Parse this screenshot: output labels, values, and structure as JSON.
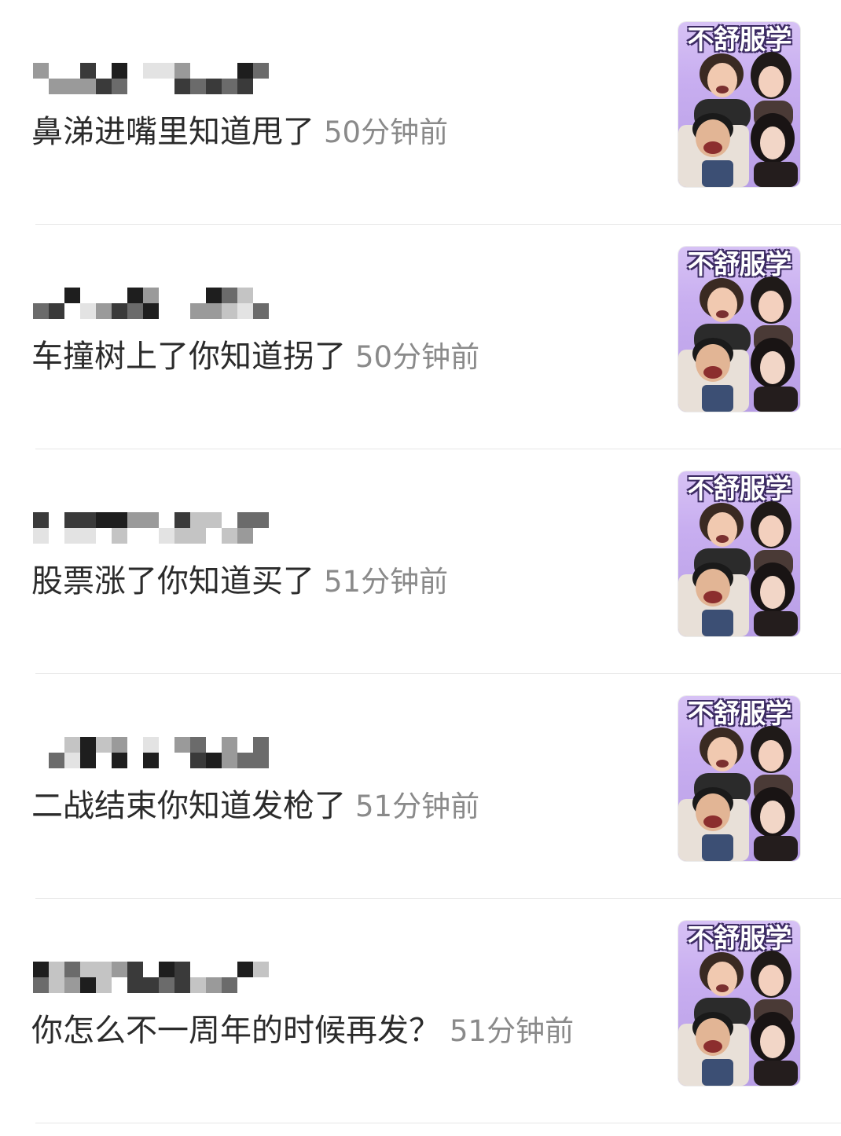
{
  "comments": [
    {
      "text": "鼻涕进嘴里知道甩了",
      "time": "50分钟前",
      "sticker_label": "不舒服学"
    },
    {
      "text": "车撞树上了你知道拐了",
      "time": "50分钟前",
      "sticker_label": "不舒服学"
    },
    {
      "text": "股票涨了你知道买了",
      "time": "51分钟前",
      "sticker_label": "不舒服学"
    },
    {
      "text": "二战结束你知道发枪了",
      "time": "51分钟前",
      "sticker_label": "不舒服学"
    },
    {
      "text": "你怎么不一周年的时候再发？",
      "time": "51分钟前",
      "sticker_label": "不舒服学"
    }
  ],
  "colors": {
    "text": "#2b2b2b",
    "time": "#8a8a8a",
    "divider": "#e6e6e6",
    "sticker_bg": "#c8aef0"
  }
}
